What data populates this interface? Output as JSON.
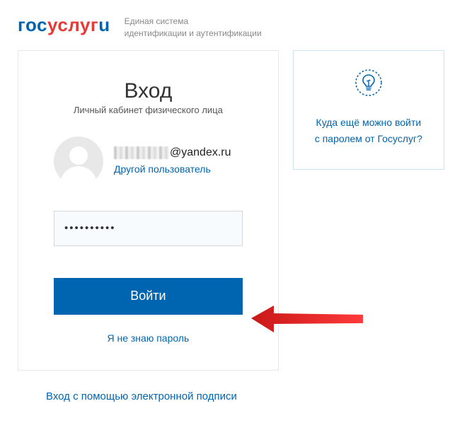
{
  "header": {
    "logo_gos": "гос",
    "logo_uslugi": "услуг",
    "logo_last": "u",
    "subtitle_line1": "Единая система",
    "subtitle_line2": "идентификации и аутентификации"
  },
  "login": {
    "title": "Вход",
    "subtitle": "Личный кабинет физического лица",
    "email_suffix": "@yandex.ru",
    "other_user": "Другой пользователь",
    "password_value": "••••••••••",
    "button_label": "Войти",
    "forgot_label": "Я не знаю пароль"
  },
  "side": {
    "line1": "Куда ещё можно войти",
    "line2": "с паролем от Госуслуг?"
  },
  "bottom": {
    "esign_link": "Вход с помощью электронной подписи"
  },
  "colors": {
    "primary": "#0065b1",
    "accent": "#e73a37"
  }
}
